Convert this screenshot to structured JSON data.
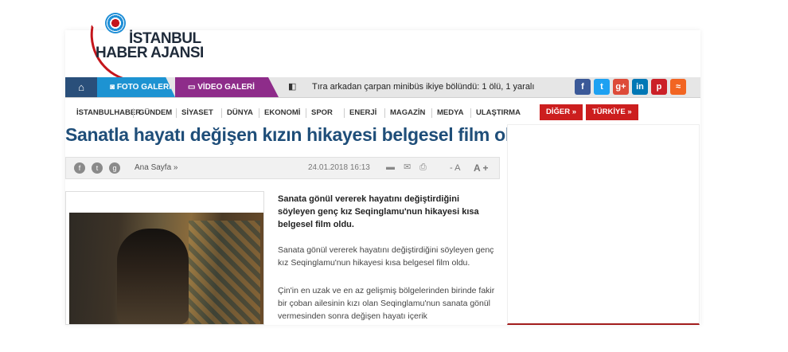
{
  "logo": {
    "line1": "İSTANBUL",
    "line2": "HABER AJANSI"
  },
  "navbar": {
    "home_icon": "home-icon",
    "foto_label": "FOTO GALERİ",
    "video_label": "VİDEO GALERİ",
    "ticker_text": "Tıra arkadan çarpan minibüs ikiye bölündü: 1 ölü, 1 yaralı",
    "social": [
      {
        "name": "facebook-icon",
        "glyph": "f",
        "color": "#3b5998"
      },
      {
        "name": "twitter-icon",
        "glyph": "t",
        "color": "#1da1f2"
      },
      {
        "name": "googleplus-icon",
        "glyph": "g+",
        "color": "#dd4b39"
      },
      {
        "name": "linkedin-icon",
        "glyph": "in",
        "color": "#0077b5"
      },
      {
        "name": "pinterest-icon",
        "glyph": "p",
        "color": "#cb2027"
      },
      {
        "name": "rss-icon",
        "glyph": "≈",
        "color": "#f26522"
      }
    ]
  },
  "categories": [
    "İSTANBULHABER",
    "GÜNDEM",
    "SİYASET",
    "DÜNYA",
    "EKONOMİ",
    "SPOR",
    "ENERJİ",
    "MAGAZİN",
    "MEDYA",
    "ULAŞTIRMA"
  ],
  "cat_buttons": [
    "DİĞER »",
    "TÜRKİYE »"
  ],
  "article": {
    "title": "Sanatla hayatı değişen kızın hikayesi belgesel film oldu",
    "breadcrumb": "Ana Sayfa »",
    "date": "24.01.2018 16:13",
    "font_smaller": "- A",
    "font_larger": "A +",
    "lead": "Sanata gönül vererek hayatını değiştirdiğini söyleyen genç kız Seqinglamu'nun hikayesi kısa belgesel film oldu.",
    "para1": "Sanata gönül vererek hayatını değiştirdiğini söyleyen genç kız Seqinglamu'nun hikayesi kısa belgesel film oldu.",
    "para2": "Çin'in en uzak ve en az gelişmiş bölgelerinden birinde fakir bir çoban ailesinin kızı olan Seqinglamu'nun sanata gönül vermesinden sonra değişen hayatı içerik"
  }
}
